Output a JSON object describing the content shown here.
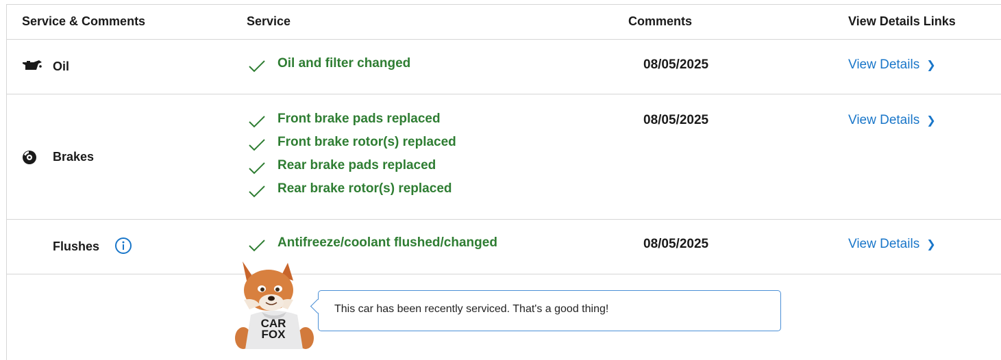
{
  "table": {
    "headers": {
      "service_comments": "Service & Comments",
      "service": "Service",
      "comments": "Comments",
      "view_details_links": "View Details Links"
    },
    "rows": [
      {
        "name": "Oil",
        "icon": "oil-can-icon",
        "services": [
          "Oil and filter changed"
        ],
        "date": "08/05/2025",
        "link": "View Details"
      },
      {
        "name": "Brakes",
        "icon": "brake-disc-icon",
        "services": [
          "Front brake pads replaced",
          "Front brake rotor(s) replaced",
          "Rear brake pads replaced",
          "Rear brake rotor(s) replaced"
        ],
        "date": "08/05/2025",
        "link": "View Details"
      },
      {
        "name": "Flushes",
        "icon": "info-icon",
        "services": [
          "Antifreeze/coolant flushed/changed"
        ],
        "date": "08/05/2025",
        "link": "View Details"
      }
    ]
  },
  "mascot": {
    "shirt_line1": "CAR",
    "shirt_line2": "FOX",
    "message": "This car has been recently serviced. That's a good thing!"
  },
  "colors": {
    "check_green": "#2e7d32",
    "link_blue": "#1976c9",
    "bubble_border": "#4a8fd6"
  }
}
